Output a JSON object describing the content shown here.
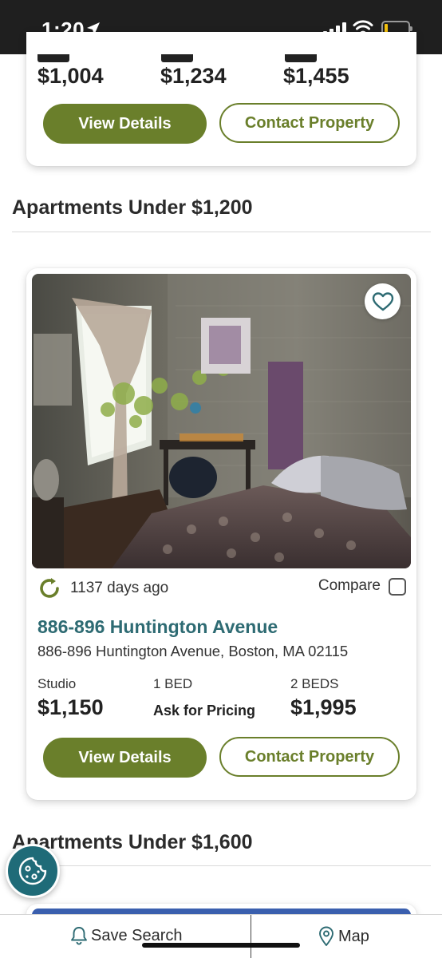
{
  "status_bar": {
    "time": "1:20"
  },
  "top_card": {
    "prices": [
      "$1,004",
      "$1,234",
      "$1,455"
    ],
    "view_details_label": "View Details",
    "contact_label": "Contact Property"
  },
  "section_1": {
    "title": "Apartments Under $1,200"
  },
  "listing": {
    "updated": "1137 days ago",
    "compare_label": "Compare",
    "compare_checked": false,
    "name": "886-896 Huntington Avenue",
    "address": "886-896 Huntington Avenue, Boston, MA 02115",
    "units": [
      {
        "label": "Studio",
        "price": "$1,150"
      },
      {
        "label": "1 BED",
        "price": "Ask for Pricing"
      },
      {
        "label": "2 BEDS",
        "price": "$1,995"
      }
    ],
    "view_details_label": "View Details",
    "contact_label": "Contact Property",
    "favorited": false
  },
  "section_2": {
    "title": "Apartments Under $1,600"
  },
  "bottom_bar": {
    "save_search_label": "Save Search",
    "map_label": "Map"
  },
  "colors": {
    "accent_green": "#6a7f2b",
    "link_teal": "#2e6b73",
    "cookie_teal": "#1f6b78"
  },
  "icons": [
    "location-arrow-icon",
    "signal-icon",
    "wifi-icon",
    "battery-icon",
    "heart-icon",
    "refresh-icon",
    "cookie-icon",
    "bell-icon",
    "map-pin-icon"
  ]
}
